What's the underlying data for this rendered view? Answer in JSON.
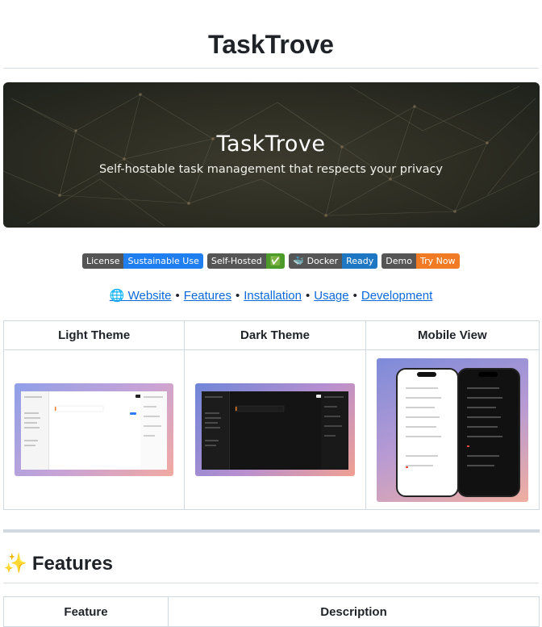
{
  "title": "TaskTrove",
  "banner": {
    "title": "TaskTrove",
    "subtitle": "Self-hostable task management that respects your privacy"
  },
  "badges": [
    {
      "label": "License",
      "value": "Sustainable Use",
      "color": "#1f7ef0"
    },
    {
      "label": "Self-Hosted",
      "value": "✅",
      "color": "#4c9a2a"
    },
    {
      "label": "🐳 Docker",
      "value": "Ready",
      "color": "#1e77c2"
    },
    {
      "label": "Demo",
      "value": "Try Now",
      "color": "#f07b24"
    }
  ],
  "links": {
    "website": "🌐 Website",
    "features": "Features",
    "installation": "Installation",
    "usage": "Usage",
    "development": "Development",
    "separator": "•"
  },
  "screenshots": {
    "headers": [
      "Light Theme",
      "Dark Theme",
      "Mobile View"
    ]
  },
  "features_section": {
    "icon": "✨",
    "heading": "Features",
    "table_headers": [
      "Feature",
      "Description"
    ]
  }
}
